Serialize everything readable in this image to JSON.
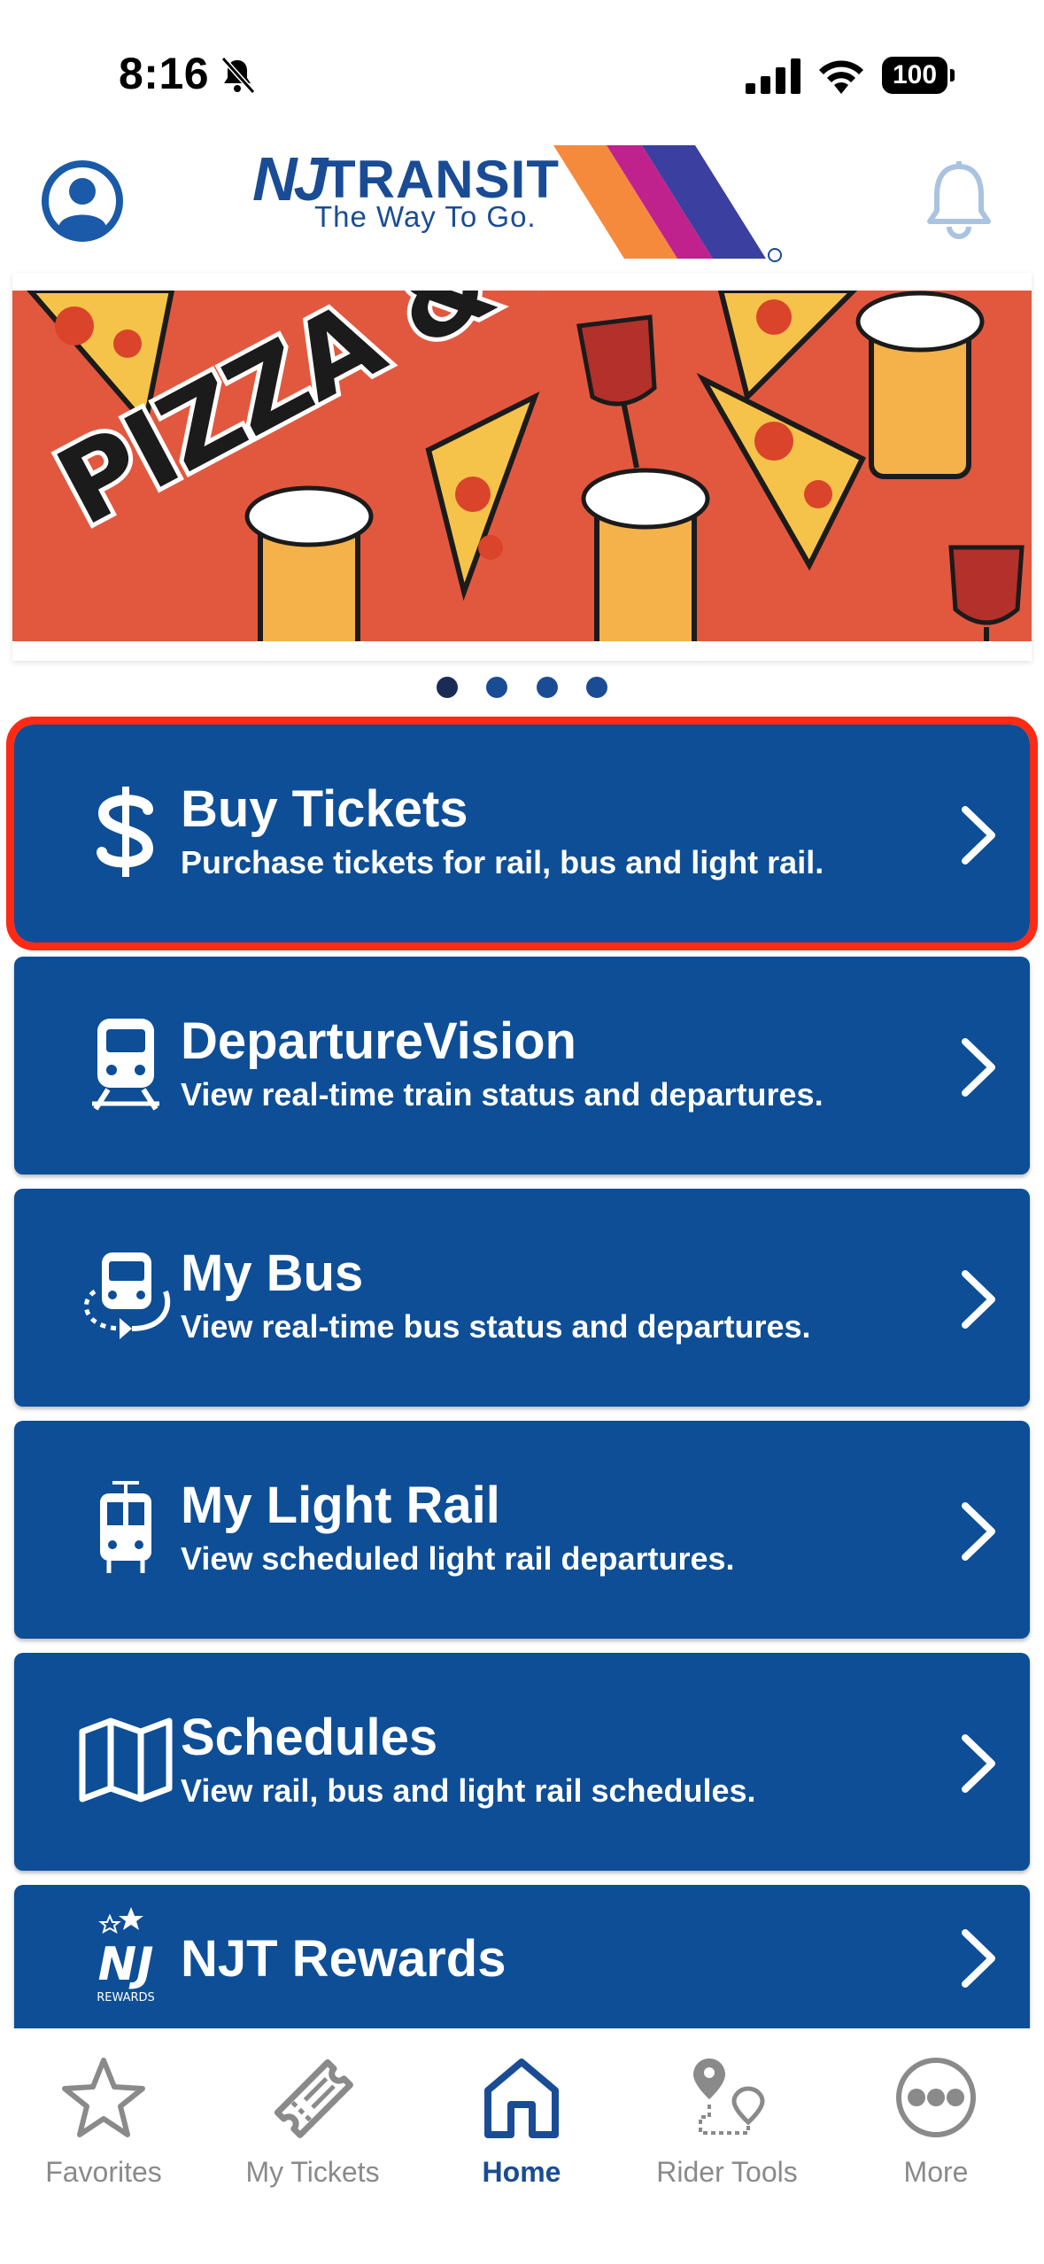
{
  "status_bar": {
    "time": "8:16",
    "battery": "100"
  },
  "header": {
    "logo_nj": "NJ",
    "logo_transit": "TRANSIT",
    "logo_tagline": "The Way To Go."
  },
  "banner": {
    "title": "PIZZA & PINTS",
    "page_count": 4,
    "active_page": 1
  },
  "menu": [
    {
      "title": "Buy Tickets",
      "subtitle": "Purchase tickets for rail, bus and light rail.",
      "icon": "dollar-icon"
    },
    {
      "title": "DepartureVision",
      "subtitle": "View real-time train status and departures.",
      "icon": "train-icon"
    },
    {
      "title": "My Bus",
      "subtitle": "View real-time bus status and departures.",
      "icon": "bus-icon"
    },
    {
      "title": "My Light Rail",
      "subtitle": "View scheduled light rail departures.",
      "icon": "light-rail-icon"
    },
    {
      "title": "Schedules",
      "subtitle": "View rail, bus and light rail schedules.",
      "icon": "map-icon"
    },
    {
      "title": "NJT Rewards",
      "subtitle": "",
      "icon": "rewards-icon"
    }
  ],
  "tabs": [
    {
      "label": "Favorites",
      "icon": "star-icon"
    },
    {
      "label": "My Tickets",
      "icon": "ticket-icon"
    },
    {
      "label": "Home",
      "icon": "home-icon",
      "active": true
    },
    {
      "label": "Rider Tools",
      "icon": "route-pin-icon"
    },
    {
      "label": "More",
      "icon": "more-dots-icon"
    }
  ],
  "colors": {
    "brand_blue": "#0d4e97",
    "highlight": "#ff2a14",
    "banner_bg": "#e2583e"
  }
}
